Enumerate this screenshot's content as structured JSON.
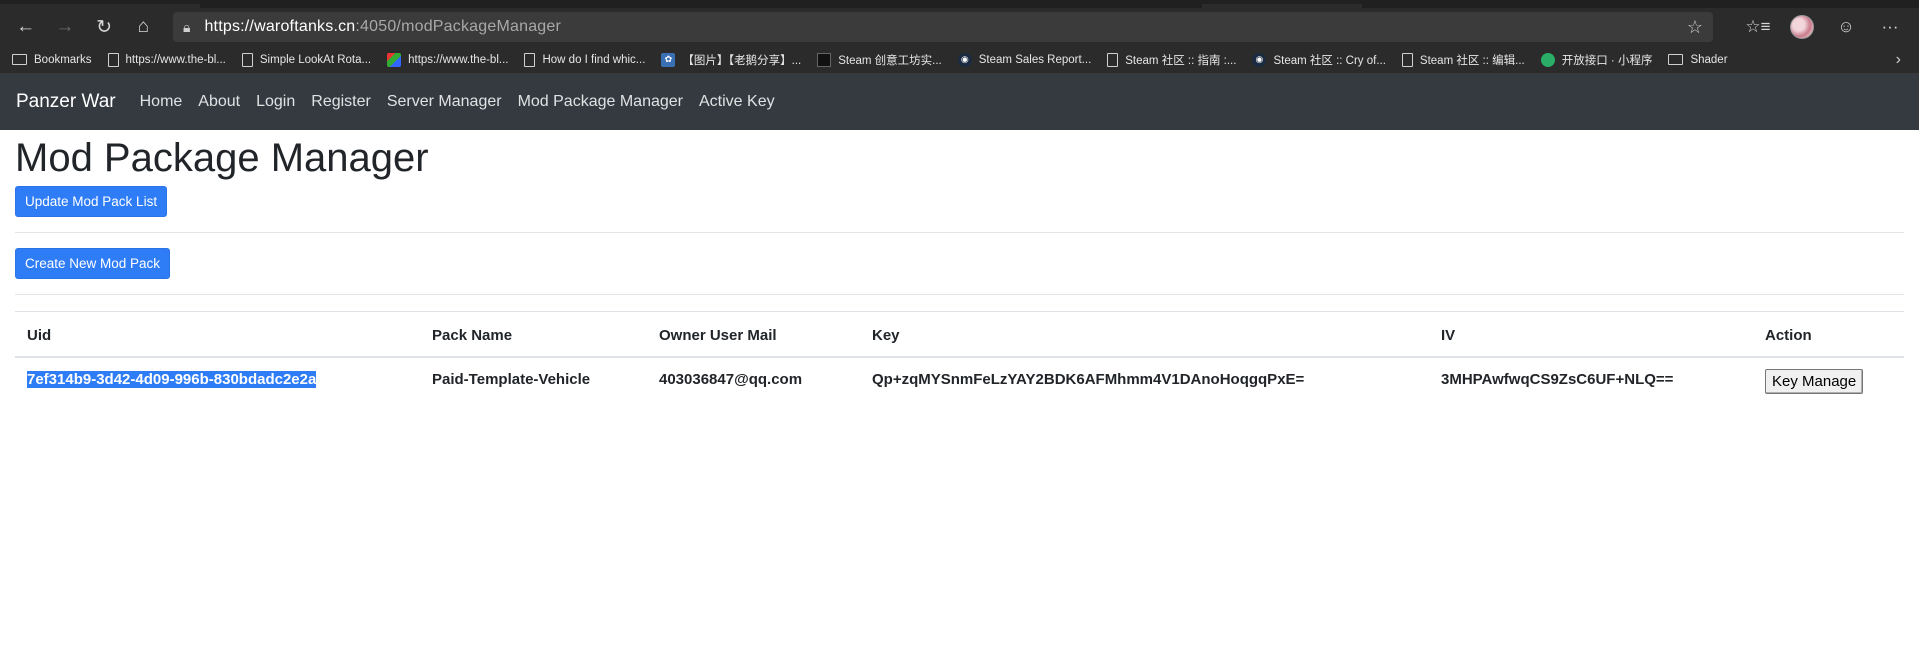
{
  "browser": {
    "url_main": "https://waroftanks.cn",
    "url_rest": ":4050/modPackageManager",
    "bookmarks": [
      {
        "label": "Bookmarks",
        "icon": "folder-icon"
      },
      {
        "label": "https://www.the-bl...",
        "icon": "page-icon"
      },
      {
        "label": "Simple LookAt Rota...",
        "icon": "page-icon"
      },
      {
        "label": "https://www.the-bl...",
        "icon": "colorful-favicon"
      },
      {
        "label": "How do I find whic...",
        "icon": "page-icon"
      },
      {
        "label": "【图片】【老鹅分享】...",
        "icon": "picture-favicon"
      },
      {
        "label": "Steam 创意工坊实...",
        "icon": "dark-favicon"
      },
      {
        "label": "Steam Sales Report...",
        "icon": "steam-icon"
      },
      {
        "label": "Steam 社区 :: 指南 :...",
        "icon": "page-icon"
      },
      {
        "label": "Steam 社区 :: Cry of...",
        "icon": "steam-icon"
      },
      {
        "label": "Steam 社区 :: 编辑...",
        "icon": "page-icon"
      },
      {
        "label": "开放接口 · 小程序",
        "icon": "wechat-icon"
      },
      {
        "label": "Shader",
        "icon": "folder-icon"
      }
    ]
  },
  "navbar": {
    "brand": "Panzer War",
    "links": [
      "Home",
      "About",
      "Login",
      "Register",
      "Server Manager",
      "Mod Package Manager",
      "Active Key"
    ]
  },
  "page": {
    "title": "Mod Package Manager",
    "update_button": "Update Mod Pack List",
    "create_button": "Create New Mod Pack"
  },
  "table": {
    "headers": [
      "Uid",
      "Pack Name",
      "Owner User Mail",
      "Key",
      "IV",
      "Action"
    ],
    "rows": [
      {
        "uid": "7ef314b9-3d42-4d09-996b-830bdadc2e2a",
        "pack_name": "Paid-Template-Vehicle",
        "owner_mail": "403036847@qq.com",
        "key": "Qp+zqMYSnmFeLzYAY2BDK6AFMhmm4V1DAnoHoqgqPxE=",
        "iv": "3MHPAwfwqCS9ZsC6UF+NLQ==",
        "action": "Key Manage"
      }
    ]
  }
}
